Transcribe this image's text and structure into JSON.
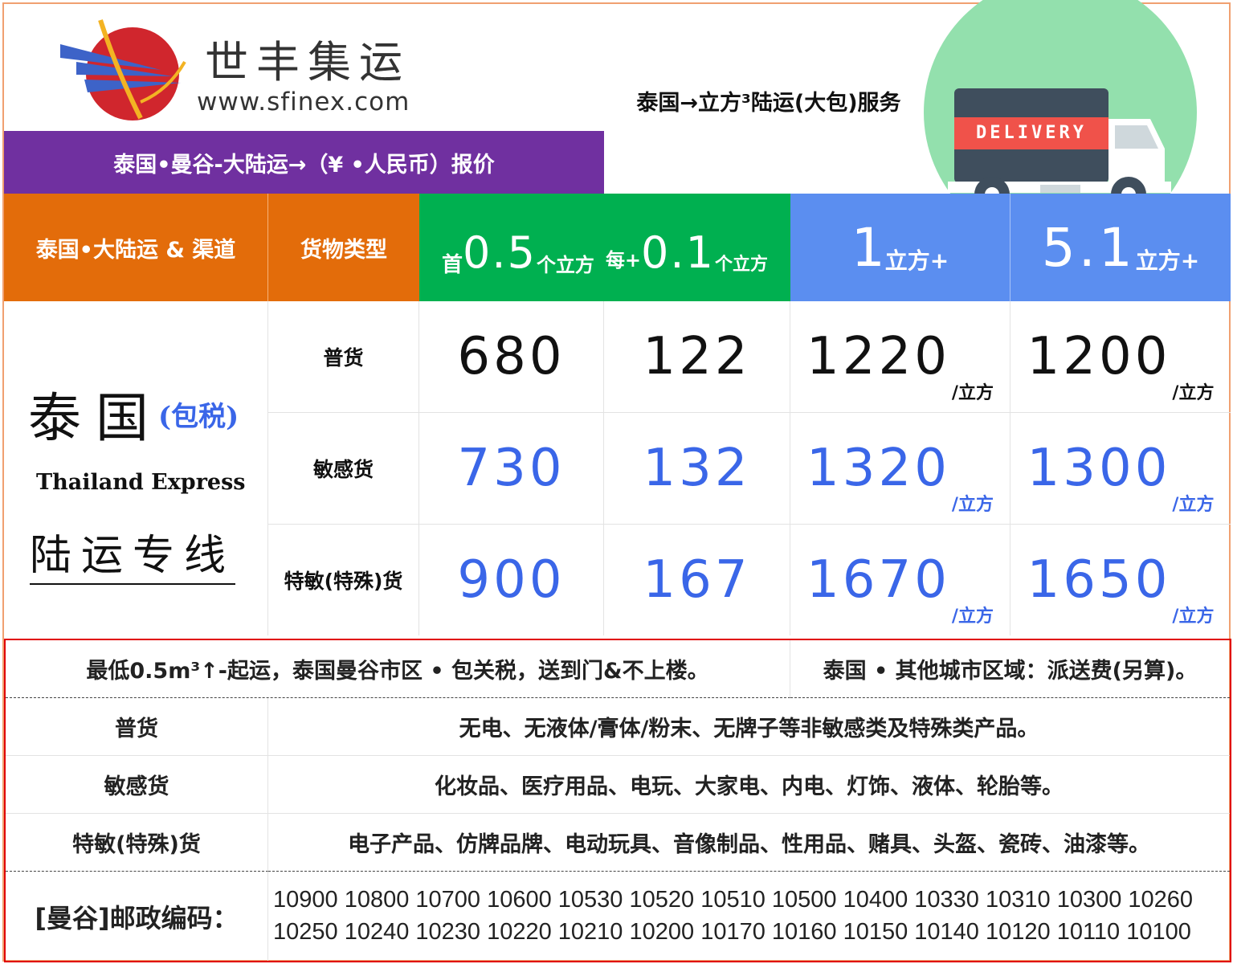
{
  "header": {
    "brand_name": "世丰集运",
    "brand_url": "www.sfinex.com",
    "service_title": "泰国→立方³陆运(大包)服务",
    "quote_banner": "泰国•曼谷-大陆运→（¥ •人民币）报价",
    "truck_label": "DELIVERY"
  },
  "columns": {
    "channel": "泰国•大陆运 & 渠道",
    "cargo_type": "货物类型",
    "first_prefix": "首",
    "first_value": "0.5",
    "first_unit": "个立方",
    "each_prefix": "每+",
    "each_value": "0.1",
    "each_unit": "个立方",
    "tier1_value": "1",
    "tier1_unit": "立方+",
    "tier2_value": "5.1",
    "tier2_unit": "立方+"
  },
  "channel_block": {
    "country": "泰国",
    "tax_note": "(包税)",
    "express_en": "Thailand Express",
    "line_name": "陆运专线"
  },
  "price_unit": "/立方",
  "rates": [
    {
      "type": "普货",
      "first": "680",
      "each": "122",
      "tier1": "1220",
      "tier2": "1200"
    },
    {
      "type": "敏感货",
      "first": "730",
      "each": "132",
      "tier1": "1320",
      "tier2": "1300"
    },
    {
      "type": "特敏(特殊)货",
      "first": "900",
      "each": "167",
      "tier1": "1670",
      "tier2": "1650"
    }
  ],
  "notes": {
    "min_note": "最低0.5m³↑-起运，泰国曼谷市区 • 包关税，送到门&不上楼。",
    "other_city_note": "泰国 • 其他城市区域：派送费(另算)。"
  },
  "categories": [
    {
      "name": "普货",
      "desc": "无电、无液体/膏体/粉末、无牌子等非敏感类及特殊类产品。"
    },
    {
      "name": "敏感货",
      "desc": "化妆品、医疗用品、电玩、大家电、内电、灯饰、液体、轮胎等。"
    },
    {
      "name": "特敏(特殊)货",
      "desc": "电子产品、仿牌品牌、电动玩具、音像制品、性用品、赌具、头盔、瓷砖、油漆等。"
    }
  ],
  "postcodes": {
    "label": "[曼谷]邮政编码：",
    "line1": "10900 10800 10700 10600 10530 10520 10510 10500 10400 10330 10310 10300 10260",
    "line2": "10250 10240 10230 10220 10210 10200 10170 10160 10150 10140 10120 10110 10100"
  },
  "colors": {
    "purple": "#7030a0",
    "orange": "#e36c0a",
    "green": "#00b050",
    "blue": "#5b8ef0",
    "price_blue": "#3a66e8",
    "border_red": "#e00000"
  }
}
